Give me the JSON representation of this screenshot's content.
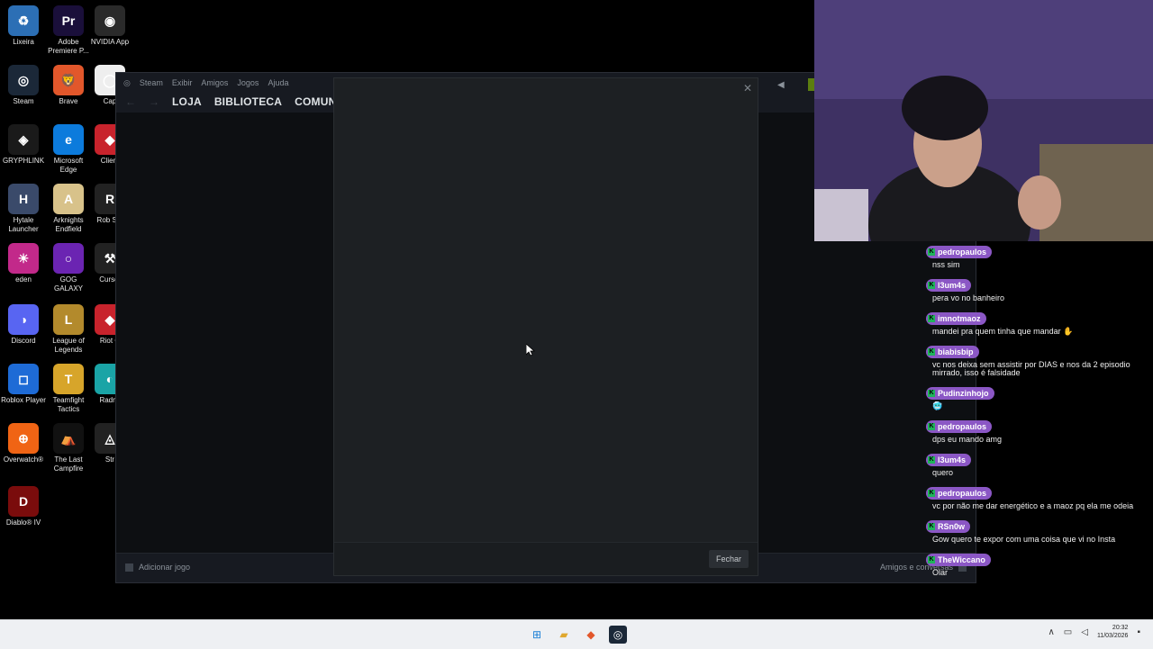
{
  "desktop": {
    "icons": [
      {
        "label": "Lixeira",
        "glyph": "♻",
        "color": "#2c6fb5"
      },
      {
        "label": "Adobe Premiere P...",
        "glyph": "Pr",
        "color": "#1a0f3a"
      },
      {
        "label": "NVIDIA App",
        "glyph": "◉",
        "color": "#2a2a2a"
      },
      {
        "label": "Steam",
        "glyph": "◎",
        "color": "#1b2838"
      },
      {
        "label": "Brave",
        "glyph": "🦁",
        "color": "#e2572b"
      },
      {
        "label": "Cap",
        "glyph": "◯",
        "color": "#eeeeee"
      },
      {
        "label": "GRYPHLINK",
        "glyph": "◈",
        "color": "#1a1a1a"
      },
      {
        "label": "Microsoft Edge",
        "glyph": "e",
        "color": "#0c7bdc"
      },
      {
        "label": "Client",
        "glyph": "◆",
        "color": "#c8232c"
      },
      {
        "label": "Hytale Launcher",
        "glyph": "H",
        "color": "#3a4a6a"
      },
      {
        "label": "Arknights Endfield",
        "glyph": "A",
        "color": "#d8c28a"
      },
      {
        "label": "Rob Stu",
        "glyph": "R",
        "color": "#222222"
      },
      {
        "label": "eden",
        "glyph": "☀",
        "color": "#c2298a"
      },
      {
        "label": "GOG GALAXY",
        "glyph": "○",
        "color": "#6b24b2"
      },
      {
        "label": "Cursef",
        "glyph": "⚒",
        "color": "#222222"
      },
      {
        "label": "Discord",
        "glyph": "◑",
        "color": "#5865f2"
      },
      {
        "label": "League of Legends",
        "glyph": "L",
        "color": "#b38a2c"
      },
      {
        "label": "Riot C",
        "glyph": "◆",
        "color": "#c8232c"
      },
      {
        "label": "Roblox Player",
        "glyph": "◻",
        "color": "#1e6bd6"
      },
      {
        "label": "Teamfight Tactics",
        "glyph": "T",
        "color": "#d7a52a"
      },
      {
        "label": "Radmi",
        "glyph": "◐",
        "color": "#1aa4a6"
      },
      {
        "label": "Overwatch®",
        "glyph": "⊕",
        "color": "#f06414"
      },
      {
        "label": "The Last Campfire",
        "glyph": "⛺",
        "color": "#111111"
      },
      {
        "label": "Str",
        "glyph": "◬",
        "color": "#222222"
      },
      {
        "label": "Diablo® IV",
        "glyph": "D",
        "color": "#7a0c0c"
      }
    ]
  },
  "steam": {
    "menu": [
      "Steam",
      "Exibir",
      "Amigos",
      "Jogos",
      "Ajuda"
    ],
    "tabs": [
      "LOJA",
      "BIBLIOTECA",
      "COMUNIDA"
    ],
    "add_game": "Adicionar jogo",
    "friends_chat": "Amigos e conversas"
  },
  "modal": {
    "close_label": "Fechar"
  },
  "chat": {
    "messages": [
      {
        "user": "pedropaulos",
        "text": "nss sim"
      },
      {
        "user": "l3um4s",
        "text": "pera vo no banheiro"
      },
      {
        "user": "imnotmaoz",
        "text": "mandei pra quem tinha que mandar ✋"
      },
      {
        "user": "biabisbip",
        "text": "vc nos deixa sem assistir por DIAS e nos da 2 episodio mirrado, isso é falsidade"
      },
      {
        "user": "Pudinzinhojo",
        "text": "🥶"
      },
      {
        "user": "pedropaulos",
        "text": "dps eu mando amg"
      },
      {
        "user": "l3um4s",
        "text": "quero"
      },
      {
        "user": "pedropaulos",
        "text": "vc por não me dar energético e a maoz pq ela me odeia"
      },
      {
        "user": "RSn0w",
        "text": "Gow quero te expor com uma coisa que vi no Insta"
      },
      {
        "user": "TheWiccano",
        "text": "Olar"
      }
    ]
  },
  "taskbar": {
    "time": "20:32",
    "date": "11/03/2026"
  }
}
